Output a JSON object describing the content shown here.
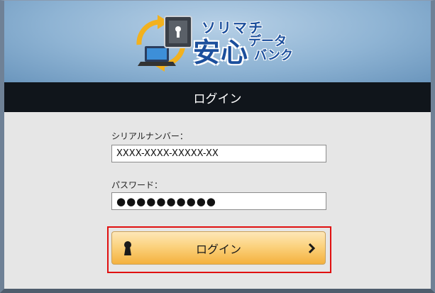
{
  "header": {
    "logo": {
      "top_text": "ソリマチ",
      "main_text": "安心",
      "sub_text_1": "データ",
      "sub_text_2": "バンク"
    },
    "colors": {
      "background": "#8fb4d4",
      "logo_blue": "#1c4f9c"
    }
  },
  "titlebar": {
    "title": "ログイン",
    "background": "#10151b"
  },
  "form": {
    "serial_label": "シリアルナンバー：",
    "serial_value": "XXXX-XXXX-XXXXX-XX",
    "password_label": "パスワード：",
    "password_value": "●●●●●●●●●●",
    "login_button_label": "ログイン",
    "login_icon": "keyhole-icon",
    "login_arrow_icon": "chevron-right-icon"
  }
}
